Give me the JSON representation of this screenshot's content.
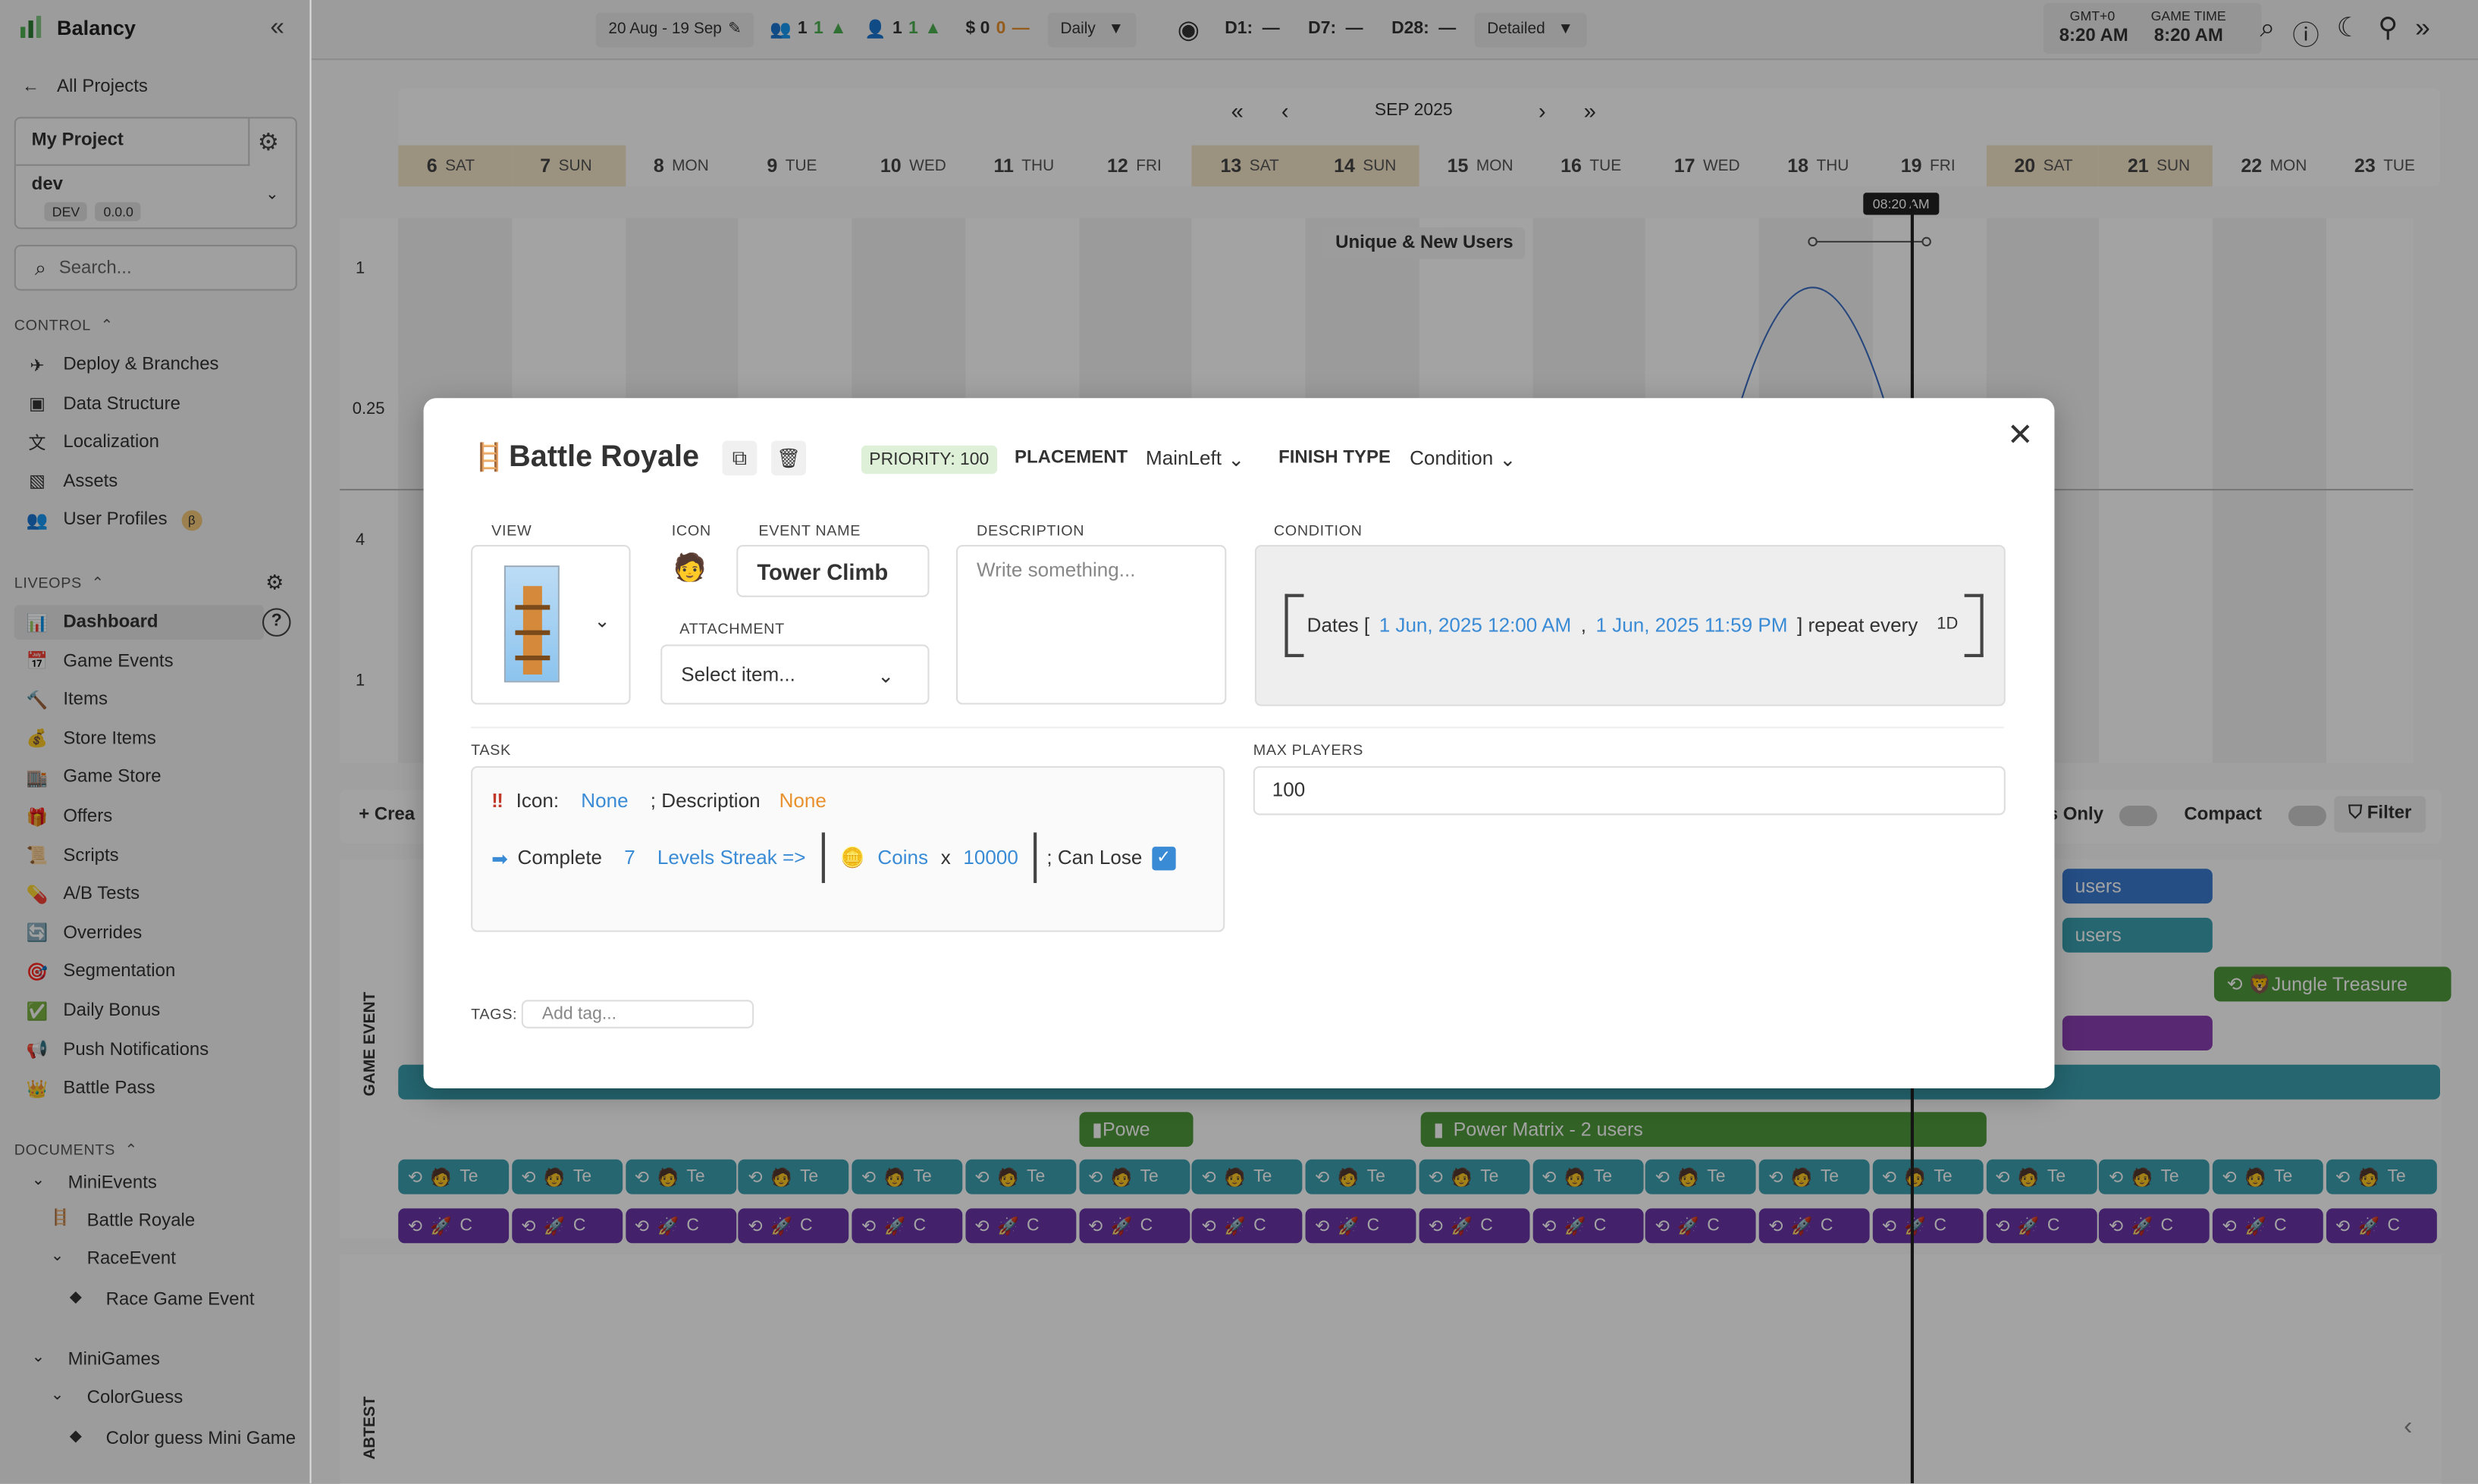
{
  "app": {
    "name": "Balancy"
  },
  "sidebar": {
    "back_label": "All Projects",
    "project": "My Project",
    "env": {
      "name": "dev",
      "badge": "DEV",
      "version": "0.0.0"
    },
    "search_placeholder": "Search...",
    "control_label": "CONTROL",
    "control_items": [
      {
        "label": "Deploy & Branches",
        "icon": "send-icon"
      },
      {
        "label": "Data Structure",
        "icon": "cube-icon"
      },
      {
        "label": "Localization",
        "icon": "translate-icon"
      },
      {
        "label": "Assets",
        "icon": "image-icon"
      },
      {
        "label": "User Profiles",
        "icon": "users-icon",
        "badge": "β"
      }
    ],
    "liveops_label": "LIVEOPS",
    "liveops_items": [
      {
        "label": "Dashboard",
        "icon": "chart-icon"
      },
      {
        "label": "Game Events",
        "icon": "events-icon"
      },
      {
        "label": "Items",
        "icon": "hammer-icon"
      },
      {
        "label": "Store Items",
        "icon": "bag-icon"
      },
      {
        "label": "Game Store",
        "icon": "store-icon"
      },
      {
        "label": "Offers",
        "icon": "gift-icon"
      },
      {
        "label": "Scripts",
        "icon": "scroll-icon"
      },
      {
        "label": "A/B Tests",
        "icon": "pill-icon"
      },
      {
        "label": "Overrides",
        "icon": "override-icon"
      },
      {
        "label": "Segmentation",
        "icon": "target-icon"
      },
      {
        "label": "Daily Bonus",
        "icon": "check-icon"
      },
      {
        "label": "Push Notifications",
        "icon": "megaphone-icon"
      },
      {
        "label": "Battle Pass",
        "icon": "crown-icon"
      }
    ],
    "documents_label": "DOCUMENTS",
    "documents": [
      {
        "label": "MiniEvents",
        "level": 0
      },
      {
        "label": "Battle Royale",
        "level": 1
      },
      {
        "label": "RaceEvent",
        "level": 1
      },
      {
        "label": "Race Game Event",
        "level": 2
      },
      {
        "label": "MiniGames",
        "level": 0
      },
      {
        "label": "ColorGuess",
        "level": 1
      },
      {
        "label": "Color guess Mini Game",
        "level": 2
      }
    ]
  },
  "topbar": {
    "date_range": "20 Aug - 19 Sep",
    "users": "1",
    "users_delta": "1",
    "new_users": "1",
    "new_users_delta": "1",
    "revenue": "$ 0",
    "revenue_delta": "0",
    "revenue_dash": "—",
    "period": "Daily",
    "d1": "D1:",
    "d1_val": "—",
    "d7": "D7:",
    "d7_val": "—",
    "d28": "D28:",
    "d28_val": "—",
    "detail": "Detailed",
    "tz_label": "GMT+0",
    "tz_time": "8:20 AM",
    "gt_label": "GAME TIME",
    "gt_time": "8:20 AM"
  },
  "calendar": {
    "month": "SEP 2025",
    "days": [
      {
        "n": "6",
        "d": "SAT"
      },
      {
        "n": "7",
        "d": "SUN"
      },
      {
        "n": "8",
        "d": "MON"
      },
      {
        "n": "9",
        "d": "TUE"
      },
      {
        "n": "10",
        "d": "WED"
      },
      {
        "n": "11",
        "d": "THU"
      },
      {
        "n": "12",
        "d": "FRI"
      },
      {
        "n": "13",
        "d": "SAT"
      },
      {
        "n": "14",
        "d": "SUN"
      },
      {
        "n": "15",
        "d": "MON"
      },
      {
        "n": "16",
        "d": "TUE"
      },
      {
        "n": "17",
        "d": "WED"
      },
      {
        "n": "18",
        "d": "THU"
      },
      {
        "n": "19",
        "d": "FRI"
      },
      {
        "n": "20",
        "d": "SAT"
      },
      {
        "n": "21",
        "d": "SUN"
      },
      {
        "n": "22",
        "d": "MON"
      },
      {
        "n": "23",
        "d": "TUE"
      }
    ],
    "now_label": "08:20 AM"
  },
  "chart": {
    "legend": "Unique & New Users",
    "y_ticks": [
      "1",
      "0.25",
      "4",
      "1"
    ]
  },
  "events": {
    "create_label": "+ Crea",
    "events_only": "ts Only",
    "compact": "Compact",
    "filter": "Filter",
    "group1": "GAME EVENT",
    "group2": "ABTEST",
    "bars": {
      "b1": "users",
      "b2": "users",
      "b3": "Jungle Treasure",
      "power_short": "Powe",
      "power_matrix": "Power Matrix - 2 users",
      "tile_te": "Te",
      "tile_c": "C"
    }
  },
  "modal": {
    "title": "Battle Royale",
    "priority": "PRIORITY: 100",
    "placement_label": "PLACEMENT",
    "placement_value": "MainLeft",
    "finish_label": "FINISH TYPE",
    "finish_value": "Condition",
    "view_label": "VIEW",
    "icon_label": "ICON",
    "event_name_label": "EVENT NAME",
    "event_name": "Tower Climb",
    "description_label": "DESCRIPTION",
    "description_placeholder": "Write something...",
    "attachment_label": "ATTACHMENT",
    "attachment_value": "Select item...",
    "condition_label": "CONDITION",
    "condition": {
      "prefix": "Dates [",
      "start": "1 Jun, 2025 12:00 AM",
      "sep": ",",
      "end": "1 Jun, 2025 11:59 PM",
      "suffix": "] repeat every",
      "repeat": "1D"
    },
    "task_label": "TASK",
    "task": {
      "icon_label": "Icon:",
      "icon_value": "None",
      "desc_label": "; Description",
      "desc_value": "None",
      "complete_label": "Complete",
      "count": "7",
      "streak_label": "Levels Streak =>",
      "reward_item": "Coins",
      "reward_x": "x",
      "reward_amount": "10000",
      "can_lose_label": "; Can Lose"
    },
    "max_players_label": "MAX PLAYERS",
    "max_players": "100",
    "tags_label": "TAGS:",
    "tags_placeholder": "Add tag..."
  },
  "colors": {
    "accent": "#3a8bd6",
    "orange": "#e8912d",
    "priority_bg": "#dff0d8",
    "weekend": "#f4e4c8"
  }
}
